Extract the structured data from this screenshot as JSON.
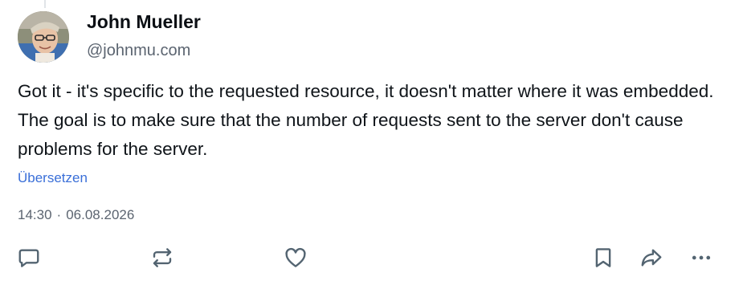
{
  "author": {
    "name": "John Mueller",
    "handle": "@johnmu.com"
  },
  "post": {
    "text": "Got it - it's specific to the requested resource, it doesn't matter where it was embedded. The goal is to make sure that the number of requests sent to the server don't cause problems for the server.",
    "translate_label": "Übersetzen",
    "time": "14:30",
    "date": "06.08.2026",
    "separator": "·"
  },
  "actions": {
    "icons": [
      "reply-icon",
      "repost-icon",
      "like-icon",
      "bookmark-icon",
      "share-icon",
      "more-icon"
    ],
    "icon_color": "#536471"
  },
  "colors": {
    "link": "#3a6fd8",
    "muted": "#5b6470",
    "text": "#0f1419"
  }
}
